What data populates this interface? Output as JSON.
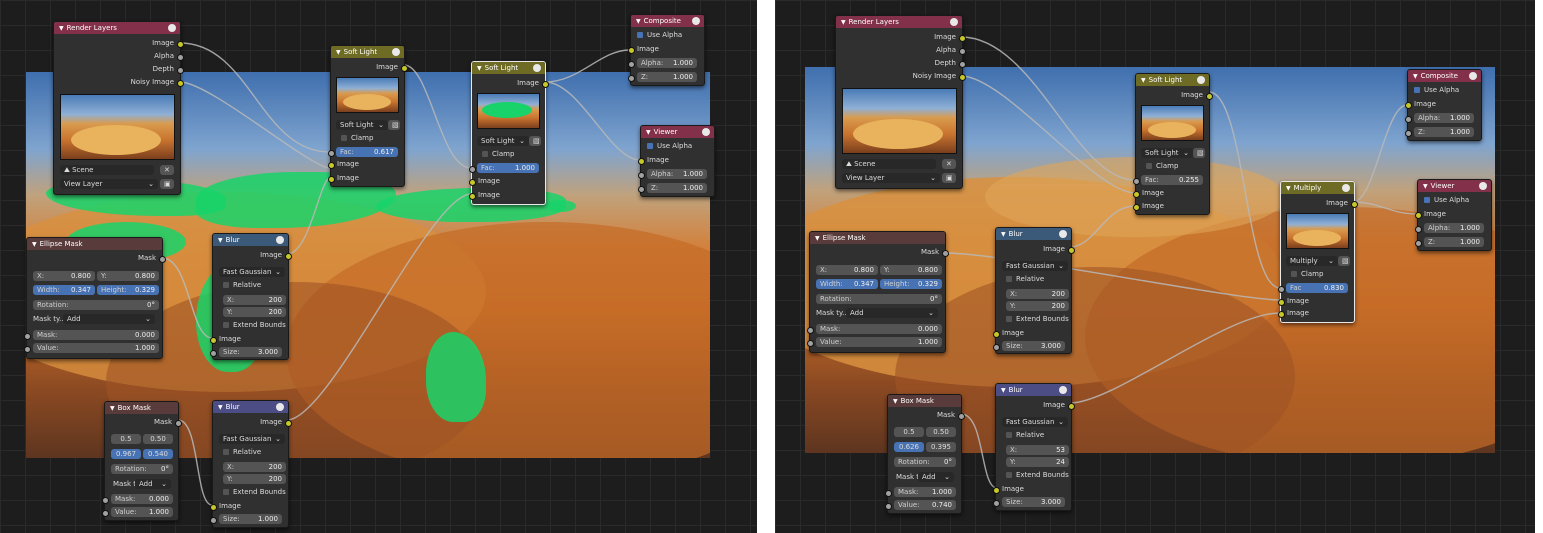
{
  "colors": {
    "header_red": "#83314a",
    "header_olive": "#6e6b25",
    "header_blue": "#3b5a7a",
    "header_purple": "#4d4d86",
    "accent_blue": "#4772b3",
    "socket_yellow": "#c7c729",
    "socket_gray": "#a1a1a1"
  },
  "common": {
    "image": "Image",
    "alpha": "Alpha",
    "depth": "Depth",
    "noisy_image": "Noisy Image",
    "mask": "Mask",
    "clamp": "Clamp",
    "fac": "Fac:",
    "fac_plain": "Fac",
    "use_alpha": "Use Alpha",
    "alpha_f": "Alpha:",
    "z_f": "Z:",
    "scene": "Scene",
    "view_layer": "View Layer",
    "fast_gaussian": "Fast Gaussian",
    "relative": "Relative",
    "x": "X:",
    "y": "Y:",
    "extend_bounds": "Extend Bounds",
    "size": "Size:",
    "width": "Width:",
    "height": "Height:",
    "rotation": "Rotation:",
    "mask_type_label": "Mask ty...",
    "mask_type_short": "Mask t",
    "add": "Add",
    "mask_f": "Mask:",
    "value": "Value:",
    "close_x": "✕"
  },
  "left": {
    "render_layers": {
      "title": "Render Layers"
    },
    "soft_light_1": {
      "title": "Soft Light",
      "mode": "Soft Light",
      "fac": "0.617"
    },
    "soft_light_2": {
      "title": "Soft Light",
      "mode": "Soft Light",
      "fac": "1.000"
    },
    "composite": {
      "title": "Composite",
      "alpha": "1.000",
      "z": "1.000"
    },
    "viewer": {
      "title": "Viewer",
      "alpha": "1.000",
      "z": "1.000"
    },
    "ellipse": {
      "title": "Ellipse Mask",
      "x": "0.800",
      "y": "0.800",
      "width": "0.347",
      "height": "0.329",
      "rotation": "0°",
      "mask_type": "Add",
      "mask": "0.000",
      "value": "1.000"
    },
    "blur_1": {
      "title": "Blur",
      "mode": "Fast Gaussian",
      "x": "200",
      "y": "200",
      "size": "3.000"
    },
    "box": {
      "title": "Box Mask",
      "x": "0.5",
      "y": "0.50",
      "w": "0.967",
      "h": "0.540",
      "rotation": "0°",
      "mask_type": "Add",
      "mask": "0.000",
      "value": "1.000"
    },
    "blur_2": {
      "title": "Blur",
      "mode": "Fast Gaussian",
      "x": "200",
      "y": "200",
      "size": "1.000"
    }
  },
  "right": {
    "render_layers": {
      "title": "Render Layers"
    },
    "soft_light": {
      "title": "Soft Light",
      "mode": "Soft Light",
      "fac": "0.255"
    },
    "composite": {
      "title": "Composite",
      "alpha": "1.000",
      "z": "1.000"
    },
    "viewer": {
      "title": "Viewer",
      "alpha": "1.000",
      "z": "1.000"
    },
    "multiply": {
      "title": "Multiply",
      "mode": "Multiply",
      "fac": "0.830"
    },
    "ellipse": {
      "title": "Ellipse Mask",
      "x": "0.800",
      "y": "0.800",
      "width": "0.347",
      "height": "0.329",
      "rotation": "0°",
      "mask_type": "Add",
      "mask": "0.000",
      "value": "1.000"
    },
    "blur_1": {
      "title": "Blur",
      "mode": "Fast Gaussian",
      "x": "200",
      "y": "200",
      "size": "3.000"
    },
    "box": {
      "title": "Box Mask",
      "x": "0.5",
      "y": "0.50",
      "w": "0.626",
      "h": "0.395",
      "rotation": "0°",
      "mask_type": "Add",
      "mask": "1.000",
      "value": "0.740"
    },
    "blur_2": {
      "title": "Blur",
      "mode": "Fast Gaussian",
      "x": "53",
      "y": "24",
      "size": "3.000"
    }
  }
}
